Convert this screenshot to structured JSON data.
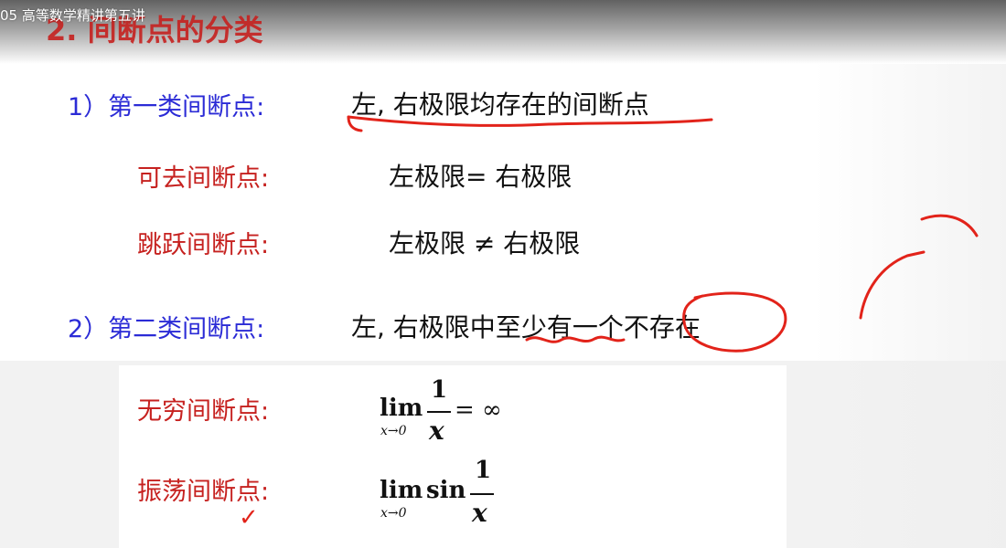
{
  "window": {
    "video_title": "05 高等数学精讲第五讲",
    "slide_heading": "2. 间断点的分类"
  },
  "slide": {
    "first_kind": {
      "label": "1）第一类间断点:",
      "definition": "左, 右极限均存在的间断点"
    },
    "removable": {
      "label": "可去间断点:",
      "condition": "左极限= 右极限"
    },
    "jump": {
      "label": "跳跃间断点:",
      "condition": "左极限 ≠ 右极限"
    },
    "second_kind": {
      "label": "2）第二类间断点:",
      "definition_prefix": "左, 右极限中",
      "definition_underlined": "至少有",
      "definition_middle": "一个",
      "definition_circled": "不存在"
    },
    "infinite": {
      "label": "无穷间断点:",
      "formula": {
        "lim": "lim",
        "sub": "x→0",
        "numerator": "1",
        "denominator": "x",
        "tail": "= ∞"
      }
    },
    "oscillating": {
      "label": "振荡间断点:",
      "formula": {
        "lim": "lim",
        "sub": "x→0",
        "func": "sin",
        "numerator": "1",
        "denominator": "x"
      }
    },
    "check_mark": "✓"
  },
  "colors": {
    "heading_red": "#c6211f",
    "label_blue": "#2b2bd6",
    "ink_red": "#e2231a",
    "text_black": "#111111"
  }
}
